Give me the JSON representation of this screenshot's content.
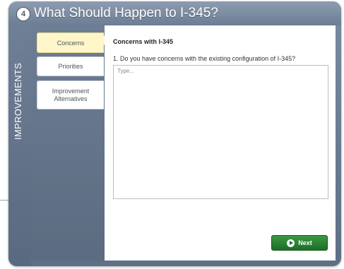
{
  "window": {
    "step_number": "4",
    "title": "What Should Happen to I-345?"
  },
  "sidebar": {
    "vertical_label": "IMPROVEMENTS",
    "tabs": [
      {
        "label": "Concerns",
        "active": true
      },
      {
        "label": "Priorities",
        "active": false
      },
      {
        "label": "Improvement Alternatives",
        "active": false
      }
    ]
  },
  "main": {
    "section_title": "Concerns with I-345",
    "question": "1. Do you have concerns with the existing configuration of I-345?",
    "answer_placeholder": "Type...",
    "answer_value": ""
  },
  "footer": {
    "next_label": "Next"
  },
  "colors": {
    "active_tab": "#fff6c9",
    "frame": "#6c7d94",
    "next_button": "#2a8434"
  },
  "icons": {
    "step": "step-number-circle",
    "next": "arrow-right-circle-icon"
  }
}
